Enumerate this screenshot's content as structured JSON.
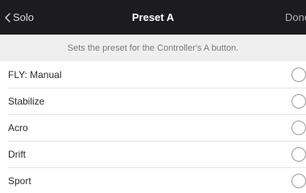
{
  "navbar": {
    "back_label": "Solo",
    "title": "Preset A",
    "done_label": "Done"
  },
  "subheader": {
    "text": "Sets the preset for the Controller's A button."
  },
  "modes": [
    {
      "label": "FLY: Manual",
      "selected": false
    },
    {
      "label": "Stabilize",
      "selected": false
    },
    {
      "label": "Acro",
      "selected": false
    },
    {
      "label": "Drift",
      "selected": false
    },
    {
      "label": "Sport",
      "selected": false
    }
  ]
}
